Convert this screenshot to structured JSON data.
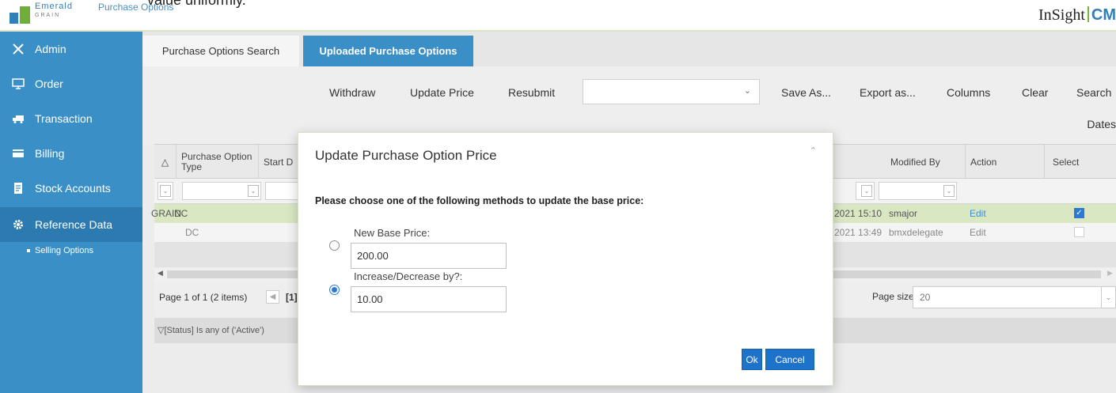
{
  "top_cut_text": "value uniformly.",
  "header": {
    "logo_text": "Emerald",
    "logo_sub": "GRAIN",
    "breadcrumb": "Purchase Options",
    "brand_left": "InSight",
    "brand_right": "CM"
  },
  "sidebar": {
    "items": [
      {
        "label": "Admin",
        "icon": "tools-icon"
      },
      {
        "label": "Order",
        "icon": "monitor-icon"
      },
      {
        "label": "Transaction",
        "icon": "truck-icon"
      },
      {
        "label": "Billing",
        "icon": "card-icon"
      },
      {
        "label": "Stock Accounts",
        "icon": "document-icon"
      },
      {
        "label": "Reference Data",
        "icon": "gear-icon"
      }
    ],
    "sub_item": "Selling Options"
  },
  "tabs": {
    "search": "Purchase Options Search",
    "uploaded": "Uploaded Purchase Options"
  },
  "toolbar": {
    "withdraw": "Withdraw",
    "update_price": "Update Price",
    "resubmit": "Resubmit",
    "save_as": "Save As...",
    "export_as": "Export as...",
    "columns": "Columns",
    "clear": "Clear",
    "search": "Search",
    "dates": "Dates"
  },
  "grid": {
    "headers": {
      "po_type": "Purchase Option Type",
      "start": "Start D",
      "modified_by": "Modified By",
      "action": "Action",
      "select": "Select"
    },
    "rows": [
      {
        "prefix": "GRAIN",
        "type": "DC",
        "modified": "2021 15:10",
        "modified_by": "smajor",
        "action": "Edit",
        "selected": true
      },
      {
        "prefix": "",
        "type": "DC",
        "modified": "2021 13:49",
        "modified_by": "bmxdelegate",
        "action": "Edit",
        "selected": false
      }
    ],
    "pager": {
      "text": "Page 1 of 1 (2 items)",
      "current": "[1]",
      "page_size_label": "Page size:",
      "page_size": "20"
    },
    "filter_status": "[Status] Is any of ('Active')"
  },
  "modal": {
    "title": "Update Purchase Option Price",
    "instruction": "Please choose one of the following methods to update the base price:",
    "option1": {
      "label": "New Base Price:",
      "value": "200.00",
      "selected": false
    },
    "option2": {
      "label": "Increase/Decrease by?:",
      "value": "10.00",
      "selected": true
    },
    "ok": "Ok",
    "cancel": "Cancel"
  },
  "colors": {
    "sidebar": "#3b8fc7",
    "active_tab": "#3b8fc7",
    "button": "#1d72c9",
    "selected_row": "#d9e8c3"
  }
}
